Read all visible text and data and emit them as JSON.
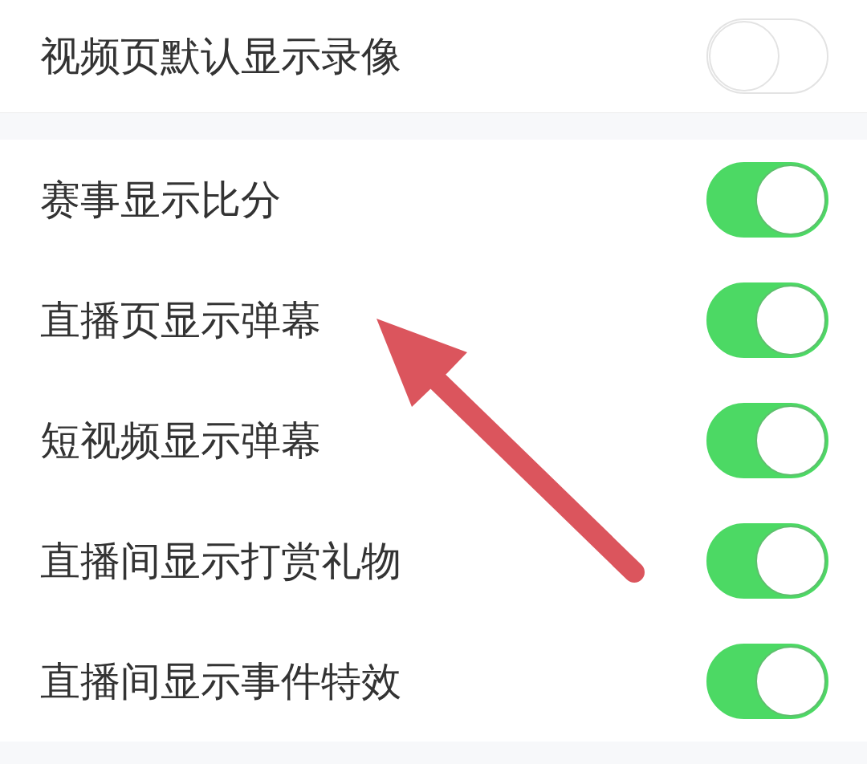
{
  "sections": [
    {
      "rows": [
        {
          "label": "视频页默认显示录像",
          "on": false
        }
      ]
    },
    {
      "rows": [
        {
          "label": "赛事显示比分",
          "on": true
        },
        {
          "label": "直播页显示弹幕",
          "on": true
        },
        {
          "label": "短视频显示弹幕",
          "on": true
        },
        {
          "label": "直播间显示打赏礼物",
          "on": true
        },
        {
          "label": "直播间显示事件特效",
          "on": true
        }
      ]
    }
  ]
}
